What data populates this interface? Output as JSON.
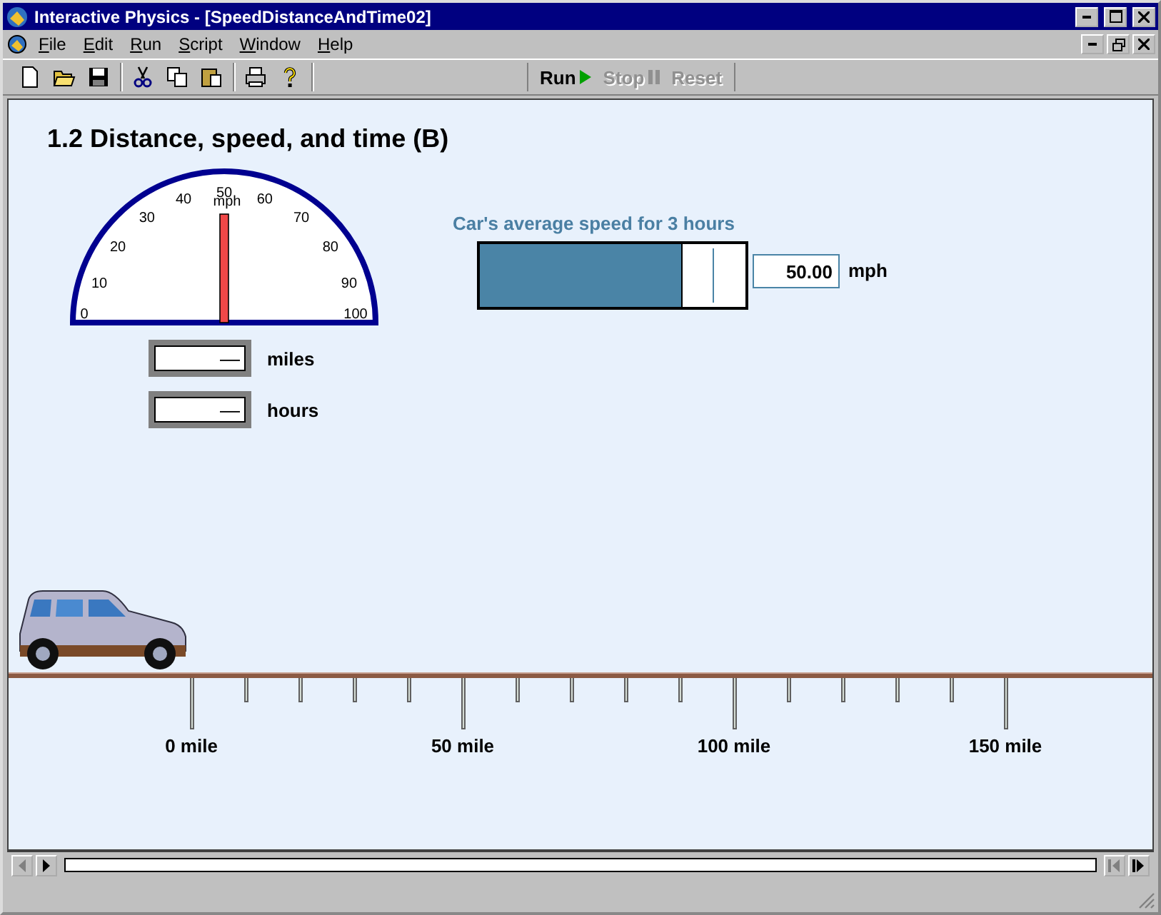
{
  "window": {
    "title": "Interactive Physics - [SpeedDistanceAndTime02]"
  },
  "menu": [
    {
      "label": "File"
    },
    {
      "label": "Edit"
    },
    {
      "label": "Run"
    },
    {
      "label": "Script"
    },
    {
      "label": "Window"
    },
    {
      "label": "Help"
    }
  ],
  "toolbar": {
    "tools": [
      {
        "kind": "new"
      },
      {
        "kind": "open"
      },
      {
        "kind": "save"
      },
      {
        "kind": "cut"
      },
      {
        "kind": "copy"
      },
      {
        "kind": "paste"
      },
      {
        "kind": "print"
      },
      {
        "kind": "help"
      }
    ],
    "run_controls": [
      {
        "kind": "run",
        "label": "Run",
        "disabled": false
      },
      {
        "kind": "stop",
        "label": "Stop",
        "disabled": true
      },
      {
        "kind": "reset",
        "label": "Reset",
        "disabled": true
      }
    ]
  },
  "canvas": {
    "heading": "1.2 Distance, speed, and time (B)",
    "speedometer": {
      "unit": "mph",
      "level": 0.5,
      "ticks": [
        "0",
        "10",
        "20",
        "30",
        "40",
        "50",
        "60",
        "70",
        "80",
        "90",
        "100"
      ]
    },
    "readouts": [
      {
        "value": "—",
        "unit": "miles"
      },
      {
        "value": "—",
        "unit": "hours"
      }
    ],
    "speed_slider": {
      "label": "Car's average speed for 3 hours",
      "level": 0.76,
      "value": "50.00",
      "unit": "mph"
    },
    "ruler": {
      "labels": [
        "0 mile",
        "50 mile",
        "100 mile",
        "150 mile"
      ]
    }
  }
}
